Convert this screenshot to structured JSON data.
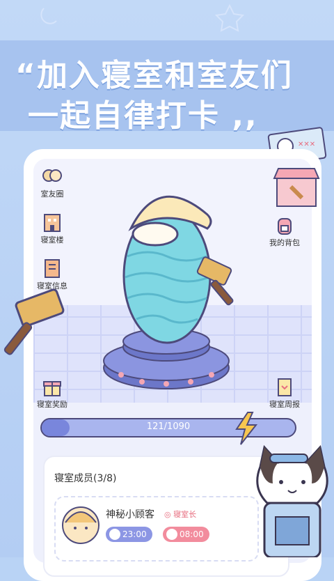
{
  "headline": {
    "line1": "“加入寝室和室友们",
    "line2": "一起自律打卡 ,,"
  },
  "left_menu": [
    {
      "label": "室友圈",
      "icon": "roommates-icon"
    },
    {
      "label": "寝室楼",
      "icon": "building-icon"
    },
    {
      "label": "寝室信息",
      "icon": "book-icon"
    },
    {
      "label": "寝室奖励",
      "icon": "gift-icon"
    }
  ],
  "right_menu": [
    {
      "label": "我的背包",
      "icon": "backpack-icon"
    },
    {
      "label": "寝室周报",
      "icon": "report-icon"
    }
  ],
  "progress": {
    "text": "121/1090",
    "fraction": 0.111
  },
  "members": {
    "title": "寝室成员(3/8)",
    "list": [
      {
        "name": "神秘小顾客",
        "role": "寝室长",
        "sleep_time": "23:00",
        "wake_time": "08:00"
      }
    ]
  },
  "colors": {
    "primary": "#7986dc",
    "banner": "#a7c3ef",
    "egg": "#7fd7e3",
    "sleep_pill": "#8c96e4",
    "wake_pill": "#f28c9d"
  }
}
